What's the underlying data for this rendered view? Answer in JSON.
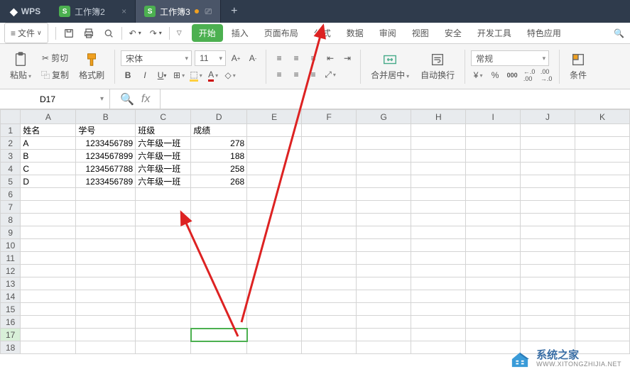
{
  "titlebar": {
    "logo": "WPS",
    "tabs": [
      {
        "label": "工作簿2",
        "active": false
      },
      {
        "label": "工作簿3",
        "active": true
      }
    ]
  },
  "menubar": {
    "file": "文件",
    "tabs": [
      "开始",
      "插入",
      "页面布局",
      "公式",
      "数据",
      "审阅",
      "视图",
      "安全",
      "开发工具",
      "特色应用"
    ],
    "active_tab": "开始"
  },
  "ribbon": {
    "cut": "剪切",
    "copy": "复制",
    "paste": "粘贴",
    "format_painter": "格式刷",
    "font_name": "宋体",
    "font_size": "11",
    "merge_center": "合并居中",
    "wrap_text": "自动换行",
    "number_format": "常规",
    "cond_format": "条件"
  },
  "namebox": {
    "value": "D17"
  },
  "grid": {
    "columns": [
      "A",
      "B",
      "C",
      "D",
      "E",
      "F",
      "G",
      "H",
      "I",
      "J",
      "K"
    ],
    "rows": 18,
    "selected_row": 17,
    "selected_cell": "D17",
    "data": {
      "headers": [
        "姓名",
        "学号",
        "班级",
        "成绩"
      ],
      "rows": [
        {
          "name": "A",
          "id": "1233456789",
          "class": "六年级一班",
          "score": 278
        },
        {
          "name": "B",
          "id": "1234567899",
          "class": "六年级一班",
          "score": 188
        },
        {
          "name": "C",
          "id": "1234567788",
          "class": "六年级一班",
          "score": 258
        },
        {
          "name": "D",
          "id": "1233456789",
          "class": "六年级一班",
          "score": 268
        }
      ]
    }
  },
  "watermark": {
    "main": "系统之家",
    "sub": "WWW.XITONGZHIJIA.NET"
  }
}
